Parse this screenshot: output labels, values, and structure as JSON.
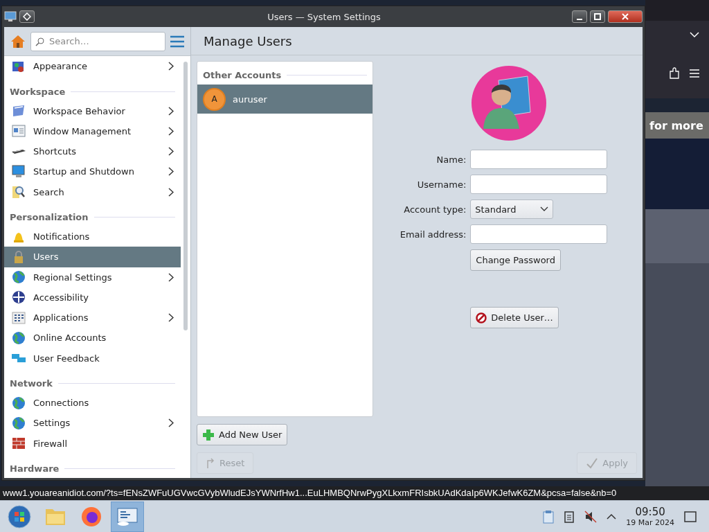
{
  "window": {
    "title": "Users — System Settings"
  },
  "sidebar": {
    "search": {
      "placeholder": "Search…"
    },
    "items": [
      {
        "kind": "item",
        "label": "Appearance",
        "has_submenu": true,
        "selected": false
      },
      {
        "kind": "header",
        "label": "Workspace"
      },
      {
        "kind": "item",
        "label": "Workspace Behavior",
        "has_submenu": true,
        "selected": false
      },
      {
        "kind": "item",
        "label": "Window Management",
        "has_submenu": true,
        "selected": false
      },
      {
        "kind": "item",
        "label": "Shortcuts",
        "has_submenu": true,
        "selected": false
      },
      {
        "kind": "item",
        "label": "Startup and Shutdown",
        "has_submenu": true,
        "selected": false
      },
      {
        "kind": "item",
        "label": "Search",
        "has_submenu": true,
        "selected": false
      },
      {
        "kind": "header",
        "label": "Personalization"
      },
      {
        "kind": "item",
        "label": "Notifications",
        "has_submenu": false,
        "selected": false
      },
      {
        "kind": "item",
        "label": "Users",
        "has_submenu": false,
        "selected": true
      },
      {
        "kind": "item",
        "label": "Regional Settings",
        "has_submenu": true,
        "selected": false
      },
      {
        "kind": "item",
        "label": "Accessibility",
        "has_submenu": false,
        "selected": false
      },
      {
        "kind": "item",
        "label": "Applications",
        "has_submenu": true,
        "selected": false
      },
      {
        "kind": "item",
        "label": "Online Accounts",
        "has_submenu": false,
        "selected": false
      },
      {
        "kind": "item",
        "label": "User Feedback",
        "has_submenu": false,
        "selected": false
      },
      {
        "kind": "header",
        "label": "Network"
      },
      {
        "kind": "item",
        "label": "Connections",
        "has_submenu": false,
        "selected": false
      },
      {
        "kind": "item",
        "label": "Settings",
        "has_submenu": true,
        "selected": false
      },
      {
        "kind": "item",
        "label": "Firewall",
        "has_submenu": false,
        "selected": false
      },
      {
        "kind": "header",
        "label": "Hardware"
      }
    ]
  },
  "page": {
    "title": "Manage Users",
    "accounts": {
      "heading": "Other Accounts",
      "users": [
        {
          "initial": "A",
          "name": "auruser",
          "selected": true
        }
      ]
    },
    "form": {
      "fields": [
        {
          "kind": "text",
          "label": "Name:"
        },
        {
          "kind": "text",
          "label": "Username:"
        },
        {
          "kind": "select",
          "label": "Account type:",
          "value": "Standard"
        },
        {
          "kind": "text",
          "label": "Email address:"
        }
      ],
      "change_password": "Change Password",
      "delete_user": "Delete User…"
    },
    "add_user": "Add New User",
    "footer_buttons": [
      {
        "kind": "reset",
        "label": "Reset",
        "disabled": true
      },
      {
        "kind": "apply",
        "label": "Apply",
        "disabled": true
      }
    ]
  },
  "browser": {
    "banner": "for more"
  },
  "status_url": "www1.youareanidiot.com/?ts=fENsZWFuUGVwcGVybWludEJsYWNrfHw1...EuLHMBQNrwPygXLkxmFRIsbkUAdKdaIp6WKJefwK6ZM&pcsa=false&nb=0",
  "taskbar": {
    "apps": [
      {
        "kind": "start",
        "selected": false
      },
      {
        "kind": "files",
        "selected": false
      },
      {
        "kind": "browser",
        "selected": false
      },
      {
        "kind": "settings",
        "selected": true
      }
    ],
    "time": "09:50",
    "date": "19 Mar 2024"
  }
}
